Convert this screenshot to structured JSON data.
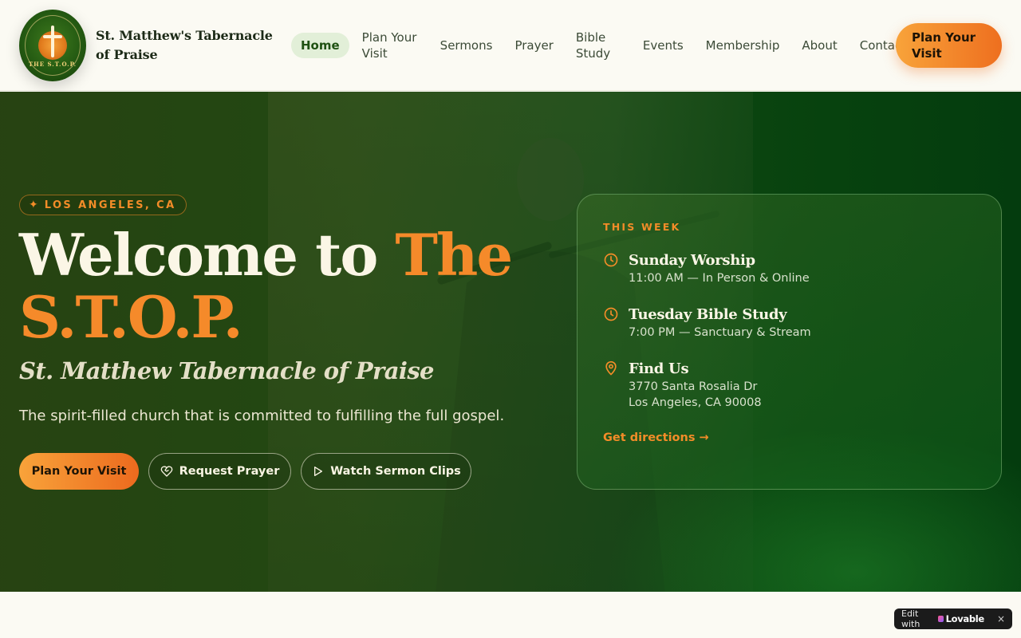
{
  "header": {
    "logo_text": "THE S.T.O.P.",
    "brand": "St. Matthew's Tabernacle of Praise",
    "nav": [
      {
        "label": "Home",
        "active": true
      },
      {
        "label": "Plan Your Visit"
      },
      {
        "label": "Sermons"
      },
      {
        "label": "Prayer"
      },
      {
        "label": "Bible Study"
      },
      {
        "label": "Events"
      },
      {
        "label": "Membership"
      },
      {
        "label": "About"
      },
      {
        "label": "Contact"
      }
    ],
    "cta": "Plan Your Visit"
  },
  "hero": {
    "location": "LOS ANGELES, CA",
    "title_part1": "Welcome to ",
    "title_accent": "The S.T.O.P.",
    "subtitle": "St. Matthew Tabernacle of Praise",
    "lead": "The spirit-filled church that is committed to fulfilling the full gospel.",
    "buttons": {
      "plan": "Plan Your Visit",
      "prayer": "Request Prayer",
      "watch": "Watch Sermon Clips"
    }
  },
  "this_week": {
    "kicker": "THIS WEEK",
    "events": [
      {
        "icon": "clock-icon",
        "title": "Sunday Worship",
        "detail": "11:00 AM — In Person & Online"
      },
      {
        "icon": "clock-icon",
        "title": "Tuesday Bible Study",
        "detail": "7:00 PM — Sanctuary & Stream"
      },
      {
        "icon": "map-pin-icon",
        "title": "Find Us",
        "detail": "3770 Santa Rosalia Dr",
        "detail2": "Los Angeles, CA 90008"
      }
    ],
    "directions": "Get directions →"
  },
  "badge": {
    "edit": "Edit with",
    "brand": "Lovable",
    "close": "×"
  },
  "colors": {
    "accent": "#f38c28",
    "brand_green": "#1f5112",
    "nav_active_bg": "#e2efd8"
  }
}
